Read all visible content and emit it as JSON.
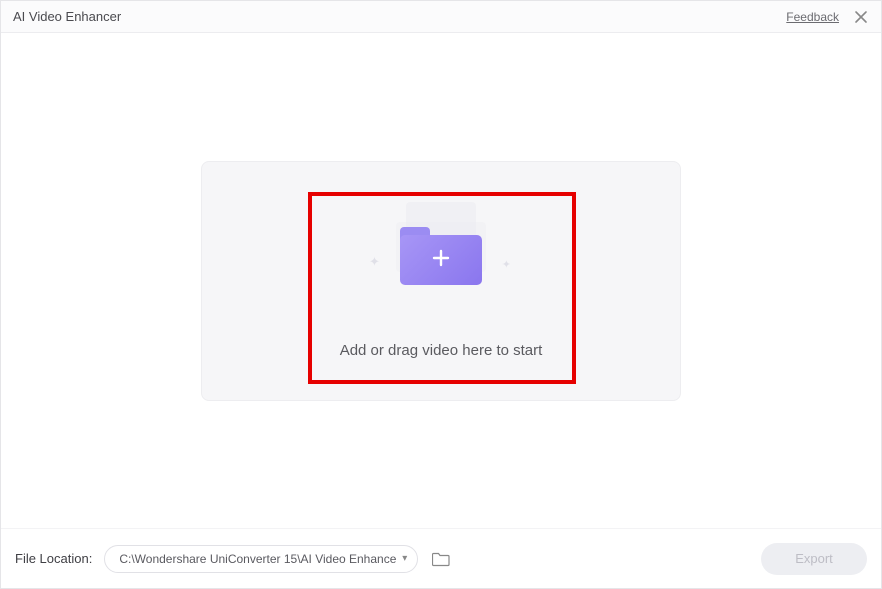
{
  "header": {
    "title": "AI Video Enhancer",
    "feedback": "Feedback"
  },
  "dropzone": {
    "instruction": "Add or drag video here to start"
  },
  "footer": {
    "label": "File Location:",
    "path": "C:\\Wondershare UniConverter 15\\AI Video Enhance",
    "export_label": "Export"
  }
}
